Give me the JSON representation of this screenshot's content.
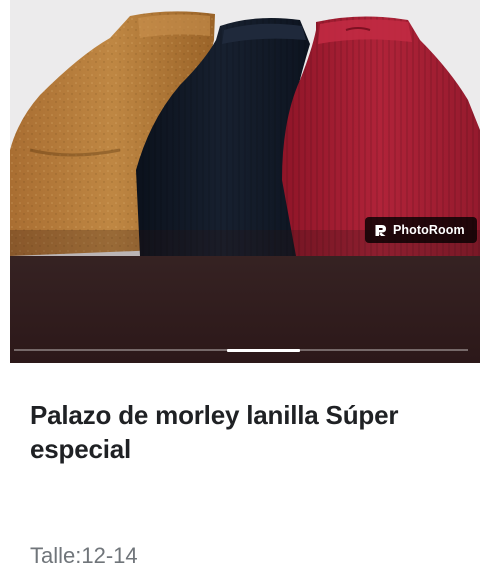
{
  "gallery": {
    "image_description_icon": "knit-pants-photo",
    "watermark_text": "PhotoRoom",
    "watermark_icon": "photoroom-logo-icon",
    "slide_progress": {
      "position_fraction": 0.55,
      "visible_fraction": 0.16
    }
  },
  "product": {
    "title": "Palazo de morley lanilla Súper especial",
    "detail": "Talle:12-14"
  },
  "colors": {
    "mustard": "#b57c3c",
    "navy": "#121a27",
    "crimson": "#a51e33",
    "gallery_bg": "#3e2b2b",
    "title_text": "#1f2124",
    "detail_text": "#70757a"
  }
}
